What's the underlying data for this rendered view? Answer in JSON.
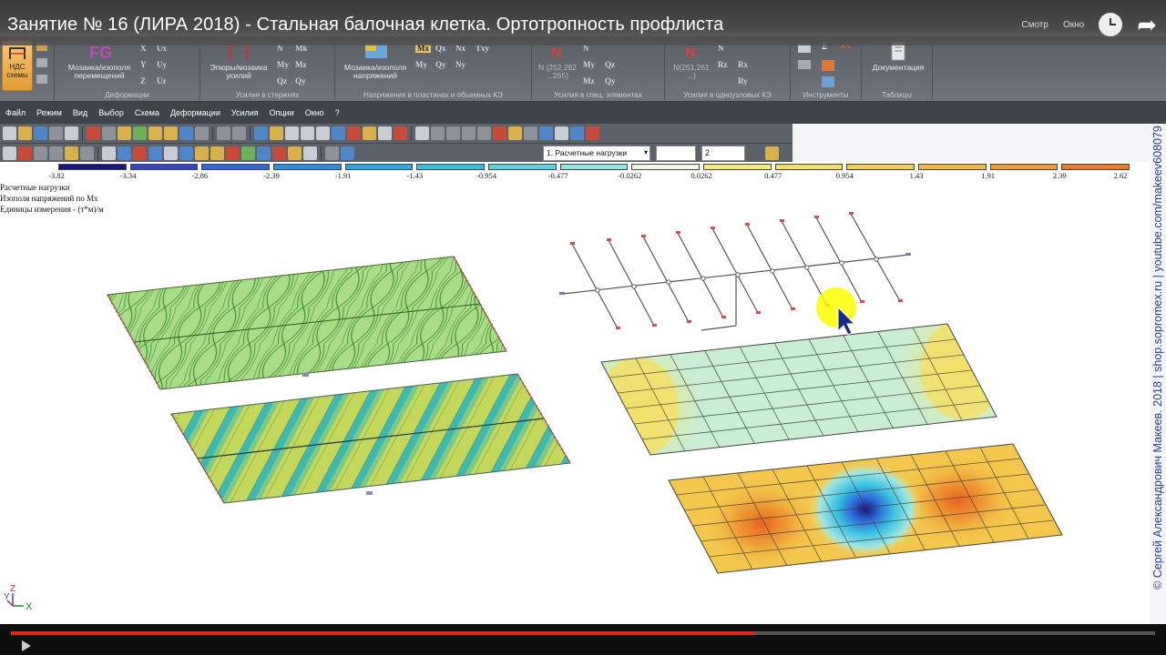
{
  "video": {
    "title": "Занятие № 16 (ЛИРА 2018) - Стальная балочная клетка. Ортотропность профлиста",
    "watch_later_hint": "Смотр",
    "share_hint": "Окно",
    "progress": 0.65
  },
  "ribbon": {
    "nds_label": "НДС\nсхемы",
    "groups": [
      {
        "caption": "Деформации",
        "big": "Мозаика/изополя\nперемещений",
        "small": [
          "X",
          "Y",
          "Z",
          "Ux",
          "Uy",
          "Uz"
        ]
      },
      {
        "caption": "Усилия в стержнях",
        "big": "Эпюры/мозаика\nусилий",
        "small": [
          "N",
          "My",
          "Qz",
          "Mk",
          "Mz",
          "Qy"
        ]
      },
      {
        "caption": "Напряжения в пластинах и объемных КЭ",
        "big": "Мозаика/изополя\nнапряжений",
        "small": [
          "Mx",
          "Qx",
          "Nx",
          "Txy",
          "My",
          "Qy",
          "Ny"
        ]
      },
      {
        "caption": "Усилия в спец. элементах",
        "big": "N (252,262\n...265)",
        "small": [
          "N",
          "My",
          "Mz",
          "Qz",
          "Qy"
        ]
      },
      {
        "caption": "Усилия в одноузловых КЭ",
        "big": "N(251,261\n...)",
        "small": [
          "N",
          "Rz",
          "Rx",
          "Ry"
        ]
      },
      {
        "caption": "Инструменты",
        "big": "",
        "small": [
          "Σ",
          "NA"
        ]
      },
      {
        "caption": "Таблицы",
        "big": "Документация",
        "small": []
      }
    ]
  },
  "menu": [
    "Файл",
    "Режим",
    "Вид",
    "Выбор",
    "Схема",
    "Деформации",
    "Усилия",
    "Опции",
    "Окно",
    "?"
  ],
  "toolbar": {
    "load_combo": "1. Расчетные нагрузки",
    "num_combo": "2"
  },
  "scale": {
    "labels": [
      "-3.82",
      "-3.34",
      "-2.86",
      "-2.39",
      "-1.91",
      "-1.43",
      "-0.954",
      "-0.477",
      "-0.0262",
      "0.0262",
      "0.477",
      "0.954",
      "1.43",
      "1.91",
      "2.39",
      "2.62"
    ],
    "colors": [
      "#1a1580",
      "#3a44c8",
      "#2f6ad8",
      "#2d8fe0",
      "#2aa9e2",
      "#38c0e0",
      "#5fd3e0",
      "#90e6e2",
      "#f2f6e8",
      "#f6ec7a",
      "#f3e06a",
      "#f2cf55",
      "#f0b944",
      "#ee9d35",
      "#ea7b27"
    ]
  },
  "info": {
    "line1": "Расчетные нагрузки",
    "line2": "Изополя напряжений по Mx",
    "line3": "Единицы измерения - (т*м)/м"
  },
  "axes": {
    "y": "Y",
    "z": "Z",
    "x": "X"
  },
  "watermark": "© Сергей Александрович Макеев. 2018 | shop.sopromex.ru | youtube.com/makeev608079",
  "colors": {
    "accent": "#e62117",
    "ribbon": "#6a6e75",
    "menubar": "#3f434a"
  }
}
